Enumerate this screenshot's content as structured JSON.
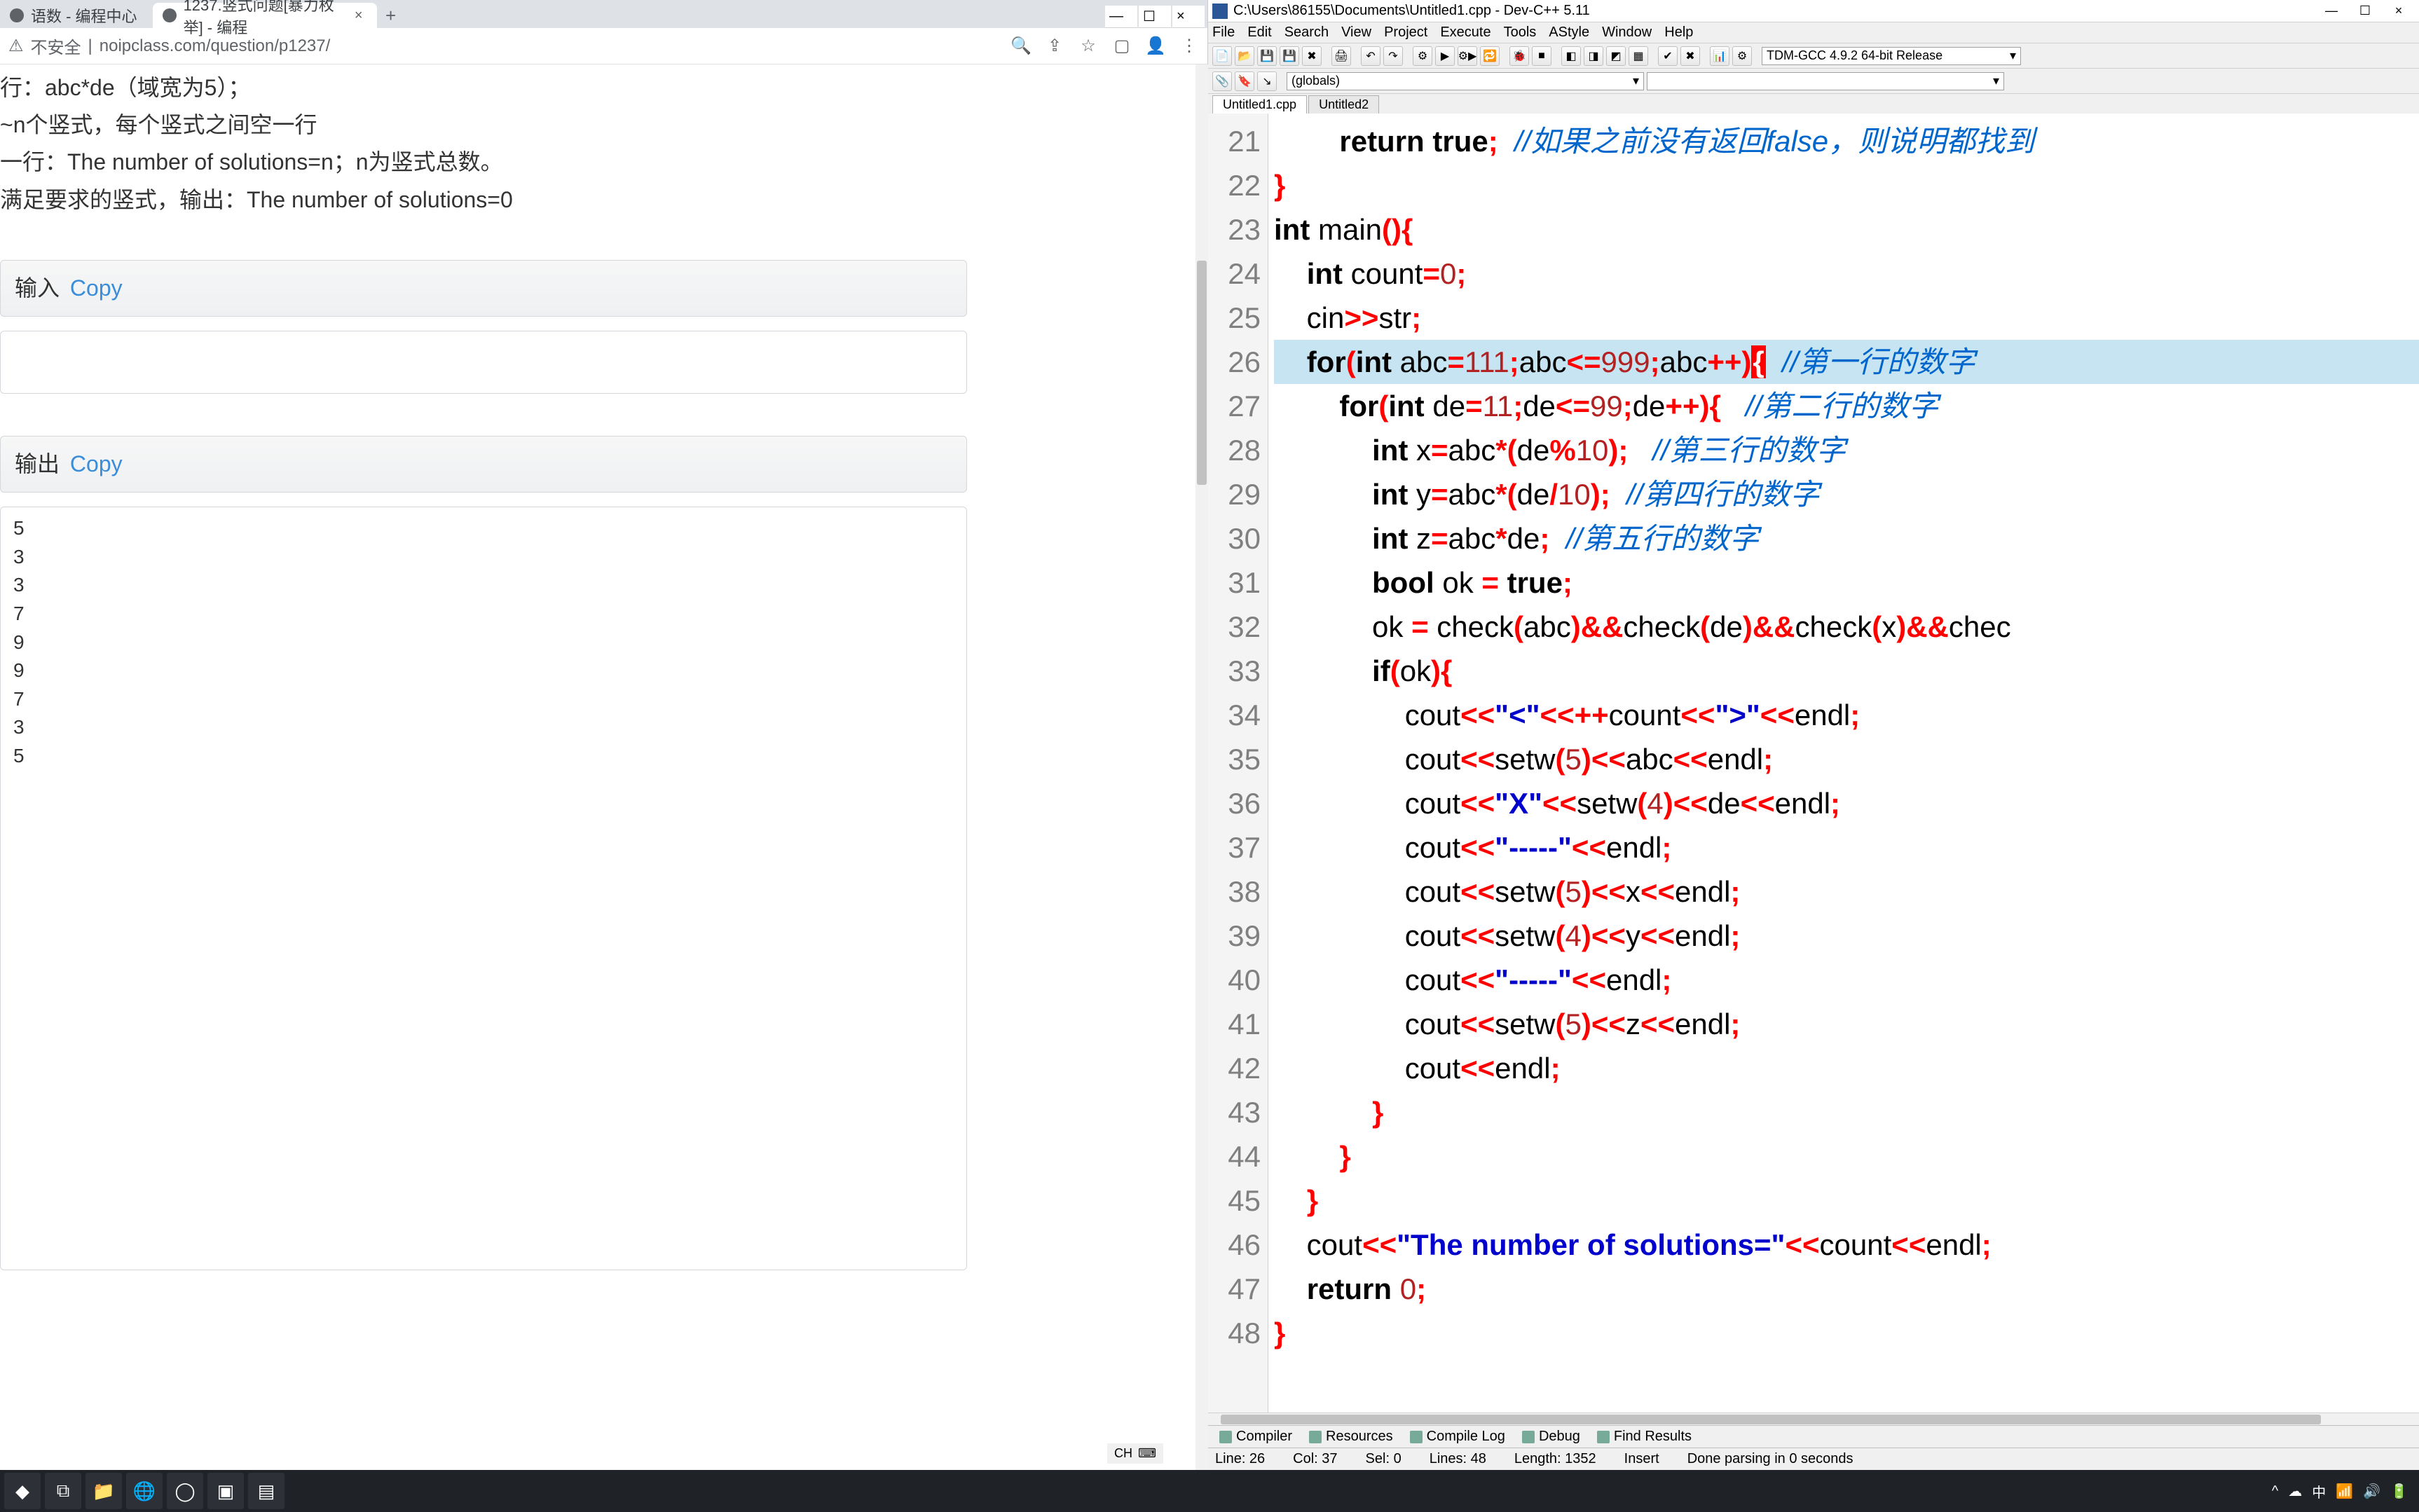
{
  "browser": {
    "tabs": [
      {
        "title": "语数 - 编程中心",
        "active": false
      },
      {
        "title": "1237.竖式问题[暴力枚举] - 编程",
        "active": true
      }
    ],
    "url_prefix": "不安全",
    "url": "noipclass.com/question/p1237/",
    "body_lines": [
      "行：abc*de（域宽为5）；",
      "~n个竖式，每个竖式之间空一行",
      "一行：The number of solutions=n；n为竖式总数。",
      "满足要求的竖式，输出：The number of solutions=0"
    ],
    "input_label": "输入",
    "output_label": "输出",
    "copy": "Copy",
    "out_numbers": [
      "5",
      "3",
      "",
      "",
      "3",
      "",
      "7",
      "",
      "9",
      "",
      "9",
      "",
      "",
      "7",
      "3",
      "5"
    ]
  },
  "devcpp": {
    "title": "C:\\Users\\86155\\Documents\\Untitled1.cpp - Dev-C++ 5.11",
    "menu": [
      "File",
      "Edit",
      "Search",
      "View",
      "Project",
      "Execute",
      "Tools",
      "AStyle",
      "Window",
      "Help"
    ],
    "compiler": "TDM-GCC 4.9.2 64-bit Release",
    "globals": "(globals)",
    "editor_tabs": [
      "Untitled1.cpp",
      "Untitled2"
    ],
    "lines": [
      {
        "n": 21,
        "seg": [
          {
            "t": "        "
          },
          {
            "t": "return ",
            "c": "kw"
          },
          {
            "t": "true",
            "c": "kw"
          },
          {
            "t": ";",
            "c": "op"
          },
          {
            "t": "  "
          },
          {
            "t": "//如果之前没有返回false，则说明都找到",
            "c": "cmt"
          }
        ]
      },
      {
        "n": 22,
        "seg": [
          {
            "t": "}",
            "c": "br1"
          }
        ]
      },
      {
        "n": 23,
        "seg": [
          {
            "t": "int ",
            "c": "kw"
          },
          {
            "t": "main"
          },
          {
            "t": "(){",
            "c": "br1"
          }
        ]
      },
      {
        "n": 24,
        "seg": [
          {
            "t": "    "
          },
          {
            "t": "int ",
            "c": "kw"
          },
          {
            "t": "count"
          },
          {
            "t": "=",
            "c": "op"
          },
          {
            "t": "0",
            "c": "num"
          },
          {
            "t": ";",
            "c": "op"
          }
        ]
      },
      {
        "n": 25,
        "seg": [
          {
            "t": "    cin"
          },
          {
            "t": ">>",
            "c": "op"
          },
          {
            "t": "str"
          },
          {
            "t": ";",
            "c": "op"
          }
        ]
      },
      {
        "n": 26,
        "hl": true,
        "seg": [
          {
            "t": "    "
          },
          {
            "t": "for",
            "c": "kw"
          },
          {
            "t": "(",
            "c": "br1"
          },
          {
            "t": "int ",
            "c": "kw"
          },
          {
            "t": "abc"
          },
          {
            "t": "=",
            "c": "op"
          },
          {
            "t": "111",
            "c": "num"
          },
          {
            "t": ";",
            "c": "op"
          },
          {
            "t": "abc"
          },
          {
            "t": "<=",
            "c": "op"
          },
          {
            "t": "999",
            "c": "num"
          },
          {
            "t": ";",
            "c": "op"
          },
          {
            "t": "abc"
          },
          {
            "t": "++",
            "c": "op"
          },
          {
            "t": ")",
            "c": "br1"
          },
          {
            "t": "{",
            "c": "cursor-br"
          },
          {
            "t": "  "
          },
          {
            "t": "//第一行的数字",
            "c": "cmt"
          }
        ]
      },
      {
        "n": 27,
        "seg": [
          {
            "t": "        "
          },
          {
            "t": "for",
            "c": "kw"
          },
          {
            "t": "(",
            "c": "br1"
          },
          {
            "t": "int ",
            "c": "kw"
          },
          {
            "t": "de"
          },
          {
            "t": "=",
            "c": "op"
          },
          {
            "t": "11",
            "c": "num"
          },
          {
            "t": ";",
            "c": "op"
          },
          {
            "t": "de"
          },
          {
            "t": "<=",
            "c": "op"
          },
          {
            "t": "99",
            "c": "num"
          },
          {
            "t": ";",
            "c": "op"
          },
          {
            "t": "de"
          },
          {
            "t": "++",
            "c": "op"
          },
          {
            "t": "){",
            "c": "br1"
          },
          {
            "t": "   "
          },
          {
            "t": "//第二行的数字",
            "c": "cmt"
          }
        ]
      },
      {
        "n": 28,
        "seg": [
          {
            "t": "            "
          },
          {
            "t": "int ",
            "c": "kw"
          },
          {
            "t": "x"
          },
          {
            "t": "=",
            "c": "op"
          },
          {
            "t": "abc"
          },
          {
            "t": "*",
            "c": "op"
          },
          {
            "t": "(",
            "c": "br1"
          },
          {
            "t": "de"
          },
          {
            "t": "%",
            "c": "op"
          },
          {
            "t": "10",
            "c": "num"
          },
          {
            "t": ");",
            "c": "br1"
          },
          {
            "t": "   "
          },
          {
            "t": "//第三行的数字",
            "c": "cmt"
          }
        ]
      },
      {
        "n": 29,
        "seg": [
          {
            "t": "            "
          },
          {
            "t": "int ",
            "c": "kw"
          },
          {
            "t": "y"
          },
          {
            "t": "=",
            "c": "op"
          },
          {
            "t": "abc"
          },
          {
            "t": "*",
            "c": "op"
          },
          {
            "t": "(",
            "c": "br1"
          },
          {
            "t": "de"
          },
          {
            "t": "/",
            "c": "op"
          },
          {
            "t": "10",
            "c": "num"
          },
          {
            "t": ");",
            "c": "br1"
          },
          {
            "t": "  "
          },
          {
            "t": "//第四行的数字",
            "c": "cmt"
          }
        ]
      },
      {
        "n": 30,
        "seg": [
          {
            "t": "            "
          },
          {
            "t": "int ",
            "c": "kw"
          },
          {
            "t": "z"
          },
          {
            "t": "=",
            "c": "op"
          },
          {
            "t": "abc"
          },
          {
            "t": "*",
            "c": "op"
          },
          {
            "t": "de"
          },
          {
            "t": ";",
            "c": "op"
          },
          {
            "t": "  "
          },
          {
            "t": "//第五行的数字",
            "c": "cmt"
          }
        ]
      },
      {
        "n": 31,
        "seg": [
          {
            "t": "            "
          },
          {
            "t": "bool ",
            "c": "kw"
          },
          {
            "t": "ok "
          },
          {
            "t": "= ",
            "c": "op"
          },
          {
            "t": "true",
            "c": "kw"
          },
          {
            "t": ";",
            "c": "op"
          }
        ]
      },
      {
        "n": 32,
        "seg": [
          {
            "t": "            ok "
          },
          {
            "t": "= ",
            "c": "op"
          },
          {
            "t": "check"
          },
          {
            "t": "(",
            "c": "br1"
          },
          {
            "t": "abc"
          },
          {
            "t": ")",
            "c": "br1"
          },
          {
            "t": "&&",
            "c": "op"
          },
          {
            "t": "check"
          },
          {
            "t": "(",
            "c": "br1"
          },
          {
            "t": "de"
          },
          {
            "t": ")",
            "c": "br1"
          },
          {
            "t": "&&",
            "c": "op"
          },
          {
            "t": "check"
          },
          {
            "t": "(",
            "c": "br1"
          },
          {
            "t": "x"
          },
          {
            "t": ")",
            "c": "br1"
          },
          {
            "t": "&&",
            "c": "op"
          },
          {
            "t": "chec"
          }
        ]
      },
      {
        "n": 33,
        "seg": [
          {
            "t": "            "
          },
          {
            "t": "if",
            "c": "kw"
          },
          {
            "t": "(",
            "c": "br1"
          },
          {
            "t": "ok"
          },
          {
            "t": "){",
            "c": "br1"
          }
        ]
      },
      {
        "n": 34,
        "seg": [
          {
            "t": "                cout"
          },
          {
            "t": "<<",
            "c": "op"
          },
          {
            "t": "\"<\"",
            "c": "str"
          },
          {
            "t": "<<++",
            "c": "op"
          },
          {
            "t": "count"
          },
          {
            "t": "<<",
            "c": "op"
          },
          {
            "t": "\">\"",
            "c": "str"
          },
          {
            "t": "<<",
            "c": "op"
          },
          {
            "t": "endl"
          },
          {
            "t": ";",
            "c": "op"
          }
        ]
      },
      {
        "n": 35,
        "seg": [
          {
            "t": "                cout"
          },
          {
            "t": "<<",
            "c": "op"
          },
          {
            "t": "setw"
          },
          {
            "t": "(",
            "c": "br1"
          },
          {
            "t": "5",
            "c": "num"
          },
          {
            "t": ")",
            "c": "br1"
          },
          {
            "t": "<<",
            "c": "op"
          },
          {
            "t": "abc"
          },
          {
            "t": "<<",
            "c": "op"
          },
          {
            "t": "endl"
          },
          {
            "t": ";",
            "c": "op"
          }
        ]
      },
      {
        "n": 36,
        "seg": [
          {
            "t": "                cout"
          },
          {
            "t": "<<",
            "c": "op"
          },
          {
            "t": "\"X\"",
            "c": "str"
          },
          {
            "t": "<<",
            "c": "op"
          },
          {
            "t": "setw"
          },
          {
            "t": "(",
            "c": "br1"
          },
          {
            "t": "4",
            "c": "num"
          },
          {
            "t": ")",
            "c": "br1"
          },
          {
            "t": "<<",
            "c": "op"
          },
          {
            "t": "de"
          },
          {
            "t": "<<",
            "c": "op"
          },
          {
            "t": "endl"
          },
          {
            "t": ";",
            "c": "op"
          }
        ]
      },
      {
        "n": 37,
        "seg": [
          {
            "t": "                cout"
          },
          {
            "t": "<<",
            "c": "op"
          },
          {
            "t": "\"-----\"",
            "c": "str"
          },
          {
            "t": "<<",
            "c": "op"
          },
          {
            "t": "endl"
          },
          {
            "t": ";",
            "c": "op"
          }
        ]
      },
      {
        "n": 38,
        "seg": [
          {
            "t": "                cout"
          },
          {
            "t": "<<",
            "c": "op"
          },
          {
            "t": "setw"
          },
          {
            "t": "(",
            "c": "br1"
          },
          {
            "t": "5",
            "c": "num"
          },
          {
            "t": ")",
            "c": "br1"
          },
          {
            "t": "<<",
            "c": "op"
          },
          {
            "t": "x"
          },
          {
            "t": "<<",
            "c": "op"
          },
          {
            "t": "endl"
          },
          {
            "t": ";",
            "c": "op"
          }
        ]
      },
      {
        "n": 39,
        "seg": [
          {
            "t": "                cout"
          },
          {
            "t": "<<",
            "c": "op"
          },
          {
            "t": "setw"
          },
          {
            "t": "(",
            "c": "br1"
          },
          {
            "t": "4",
            "c": "num"
          },
          {
            "t": ")",
            "c": "br1"
          },
          {
            "t": "<<",
            "c": "op"
          },
          {
            "t": "y"
          },
          {
            "t": "<<",
            "c": "op"
          },
          {
            "t": "endl"
          },
          {
            "t": ";",
            "c": "op"
          }
        ]
      },
      {
        "n": 40,
        "seg": [
          {
            "t": "                cout"
          },
          {
            "t": "<<",
            "c": "op"
          },
          {
            "t": "\"-----\"",
            "c": "str"
          },
          {
            "t": "<<",
            "c": "op"
          },
          {
            "t": "endl"
          },
          {
            "t": ";",
            "c": "op"
          }
        ]
      },
      {
        "n": 41,
        "seg": [
          {
            "t": "                cout"
          },
          {
            "t": "<<",
            "c": "op"
          },
          {
            "t": "setw"
          },
          {
            "t": "(",
            "c": "br1"
          },
          {
            "t": "5",
            "c": "num"
          },
          {
            "t": ")",
            "c": "br1"
          },
          {
            "t": "<<",
            "c": "op"
          },
          {
            "t": "z"
          },
          {
            "t": "<<",
            "c": "op"
          },
          {
            "t": "endl"
          },
          {
            "t": ";",
            "c": "op"
          }
        ]
      },
      {
        "n": 42,
        "seg": [
          {
            "t": "                cout"
          },
          {
            "t": "<<",
            "c": "op"
          },
          {
            "t": "endl"
          },
          {
            "t": ";",
            "c": "op"
          }
        ]
      },
      {
        "n": 43,
        "seg": [
          {
            "t": "            "
          },
          {
            "t": "}",
            "c": "br1"
          }
        ]
      },
      {
        "n": 44,
        "seg": [
          {
            "t": "        "
          },
          {
            "t": "}",
            "c": "br1"
          }
        ]
      },
      {
        "n": 45,
        "seg": [
          {
            "t": "    "
          },
          {
            "t": "}",
            "c": "br1"
          }
        ]
      },
      {
        "n": 46,
        "seg": [
          {
            "t": "    cout"
          },
          {
            "t": "<<",
            "c": "op"
          },
          {
            "t": "\"The number of solutions=\"",
            "c": "str"
          },
          {
            "t": "<<",
            "c": "op"
          },
          {
            "t": "count"
          },
          {
            "t": "<<",
            "c": "op"
          },
          {
            "t": "endl"
          },
          {
            "t": ";",
            "c": "op"
          }
        ]
      },
      {
        "n": 47,
        "seg": [
          {
            "t": "    "
          },
          {
            "t": "return ",
            "c": "kw"
          },
          {
            "t": "0",
            "c": "num"
          },
          {
            "t": ";",
            "c": "op"
          }
        ]
      },
      {
        "n": 48,
        "seg": [
          {
            "t": "}",
            "c": "br1"
          }
        ]
      }
    ],
    "bottom_tabs": [
      "Compiler",
      "Resources",
      "Compile Log",
      "Debug",
      "Find Results"
    ],
    "status": {
      "line": "Line:   26",
      "col": "Col:   37",
      "sel": "Sel:   0",
      "lines": "Lines:   48",
      "length": "Length:  1352",
      "insert": "Insert",
      "parse": "Done parsing in 0 seconds"
    },
    "left_status": "CH"
  }
}
